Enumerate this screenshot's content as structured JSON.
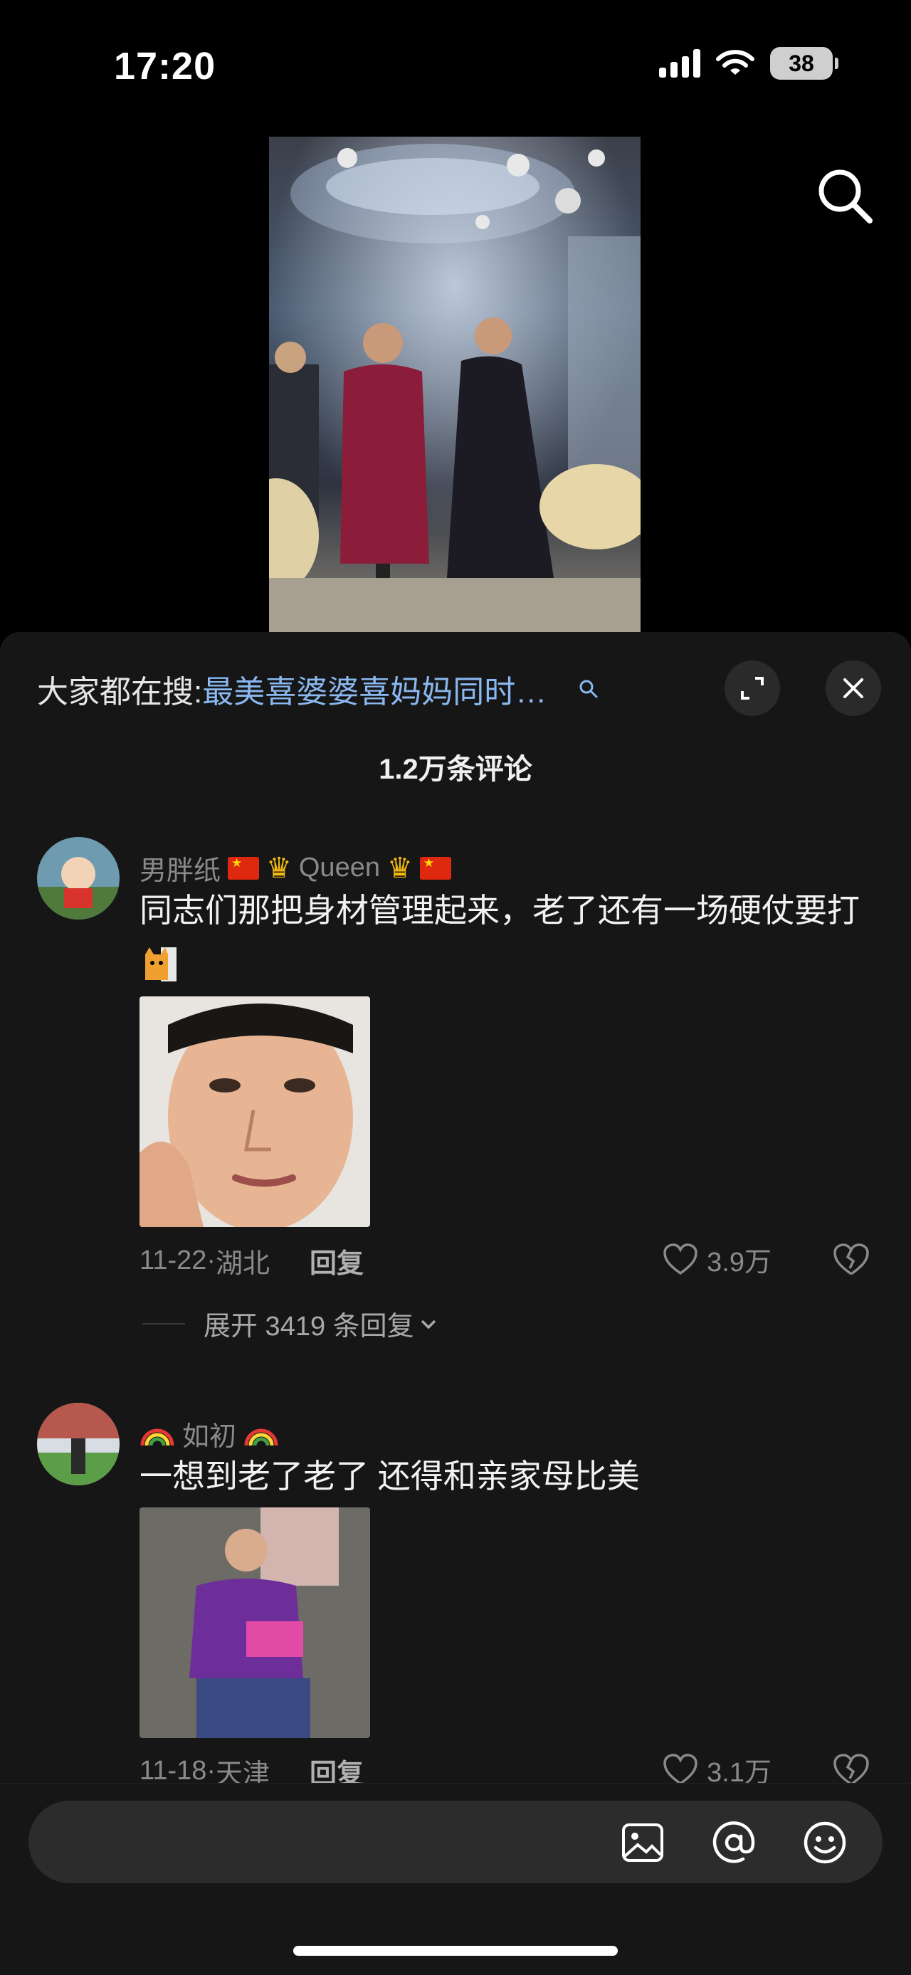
{
  "status_bar": {
    "time": "17:20",
    "battery": "38"
  },
  "hot_search": {
    "prefix": "大家都在搜:",
    "query": "最美喜婆婆喜妈妈同时…"
  },
  "comments_header": {
    "count": "1.2万条评论"
  },
  "comments": [
    {
      "username": "男胖纸",
      "username_suffix": "Queen",
      "text": "同志们那把身材管理起来，老了还有一场硬仗要打",
      "date": "11-22",
      "location": "湖北",
      "reply_label": "回复",
      "likes": "3.9万",
      "expand_label": "展开 3419 条回复"
    },
    {
      "username": "如初",
      "text": "一想到老了老了 还得和亲家母比美",
      "date": "11-18",
      "location": "天津",
      "reply_label": "回复",
      "likes": "3.1万"
    }
  ],
  "colors": {
    "sheet_bg": "#161616",
    "query_blue": "#8ab8f0",
    "flag_red": "#de2910"
  },
  "icons": [
    "search-icon",
    "fullscreen-icon",
    "close-icon",
    "heart-icon",
    "broken-heart-icon",
    "image-icon",
    "at-icon",
    "emoji-icon"
  ]
}
